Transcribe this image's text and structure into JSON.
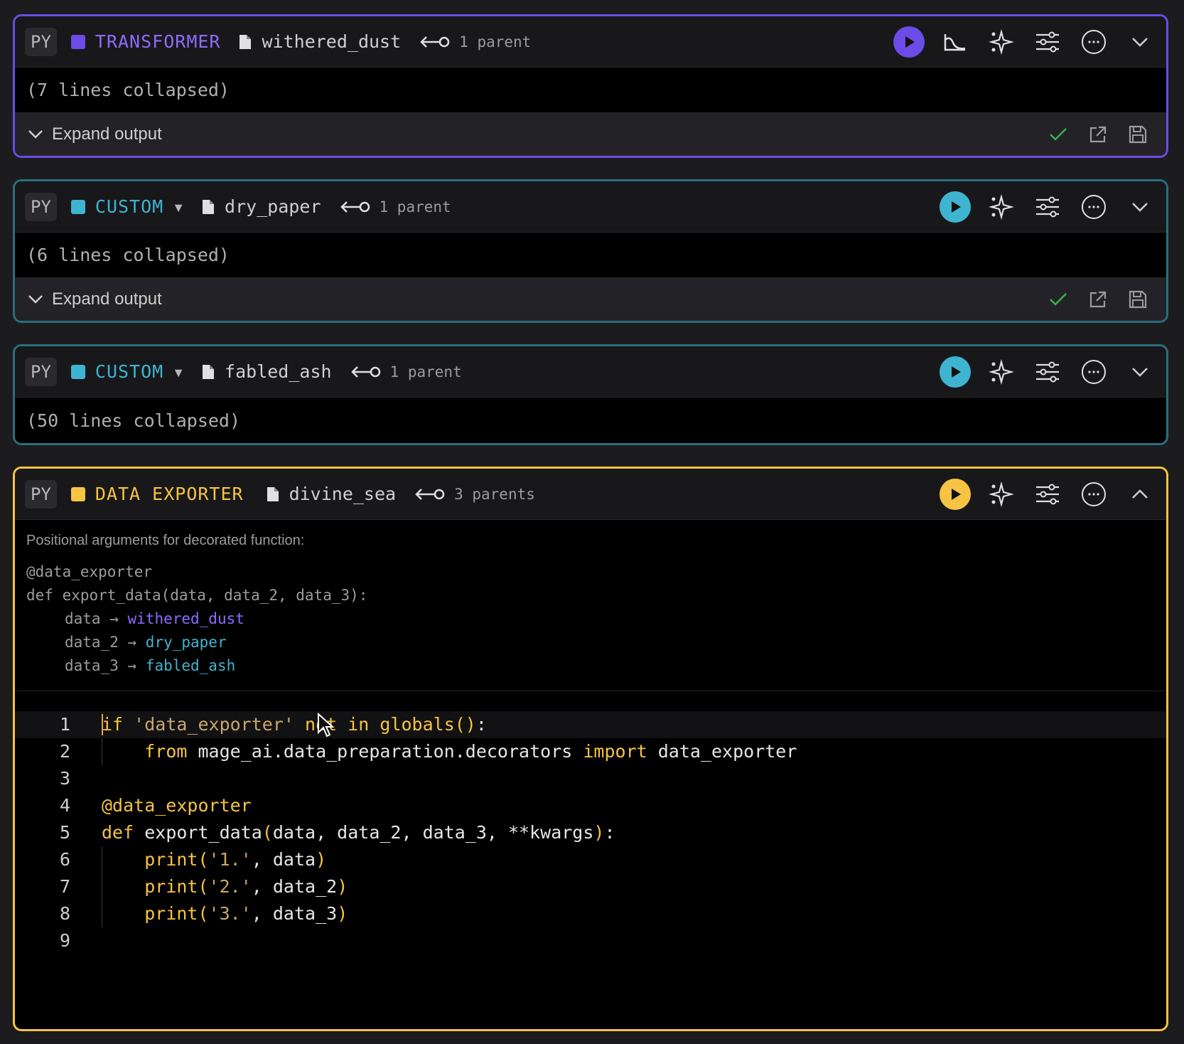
{
  "blocks": [
    {
      "language": "PY",
      "type_label": "TRANSFORMER",
      "type_color": "#6b4ce6",
      "name": "withered_dust",
      "parents": "1 parent",
      "collapsed_text": "(7 lines collapsed)",
      "output_label": "Expand output"
    },
    {
      "language": "PY",
      "type_label": "CUSTOM",
      "type_color": "#3fb4d0",
      "name": "dry_paper",
      "parents": "1 parent",
      "collapsed_text": "(6 lines collapsed)",
      "output_label": "Expand output"
    },
    {
      "language": "PY",
      "type_label": "CUSTOM",
      "type_color": "#3fb4d0",
      "name": "fabled_ash",
      "parents": "1 parent",
      "collapsed_text": "(50 lines collapsed)"
    },
    {
      "language": "PY",
      "type_label": "DATA EXPORTER",
      "type_color": "#f7c342",
      "name": "divine_sea",
      "parents": "3 parents",
      "args_hint": "Positional arguments for decorated function:",
      "args_decorator": "@data_exporter",
      "args_def": "def export_data(data, data_2, data_3):",
      "arg_map": [
        {
          "arg": "data",
          "target": "withered_dust"
        },
        {
          "arg": "data_2",
          "target": "dry_paper"
        },
        {
          "arg": "data_3",
          "target": "fabled_ash"
        }
      ],
      "code": {
        "line_numbers": [
          "1",
          "2",
          "3",
          "4",
          "5",
          "6",
          "7",
          "8",
          "9"
        ],
        "l1": {
          "kw1": "if",
          "str": "'data_exporter'",
          "mid": "not in",
          "fn": "globals",
          "paren": "()",
          "end": ":"
        },
        "l2": {
          "kw1": "from",
          "mod": "mage_ai.data_preparation.decorators",
          "kw2": "import",
          "name": "data_exporter"
        },
        "l4": {
          "dec": "@data_exporter"
        },
        "l5": {
          "kw": "def",
          "fn": "export_data",
          "open": "(",
          "params": "data, data_2, data_3, **kwargs",
          "close": ")",
          "end": ":"
        },
        "l6": {
          "fn": "print",
          "open": "(",
          "str": "'1.'",
          "rest": ", data",
          "close": ")"
        },
        "l7": {
          "fn": "print",
          "open": "(",
          "str": "'2.'",
          "rest": ", data_2",
          "close": ")"
        },
        "l8": {
          "fn": "print",
          "open": "(",
          "str": "'3.'",
          "rest": ", data_3",
          "close": ")"
        }
      }
    }
  ],
  "icons": {
    "file": "file-icon",
    "parent": "parent-link-icon",
    "run": "play-icon",
    "chart": "chart-icon",
    "ai": "sparkle-icon",
    "settings": "sliders-icon",
    "more": "more-icon",
    "collapse": "chevron-icon",
    "success": "check-icon",
    "open": "external-link-icon",
    "save": "save-icon"
  }
}
